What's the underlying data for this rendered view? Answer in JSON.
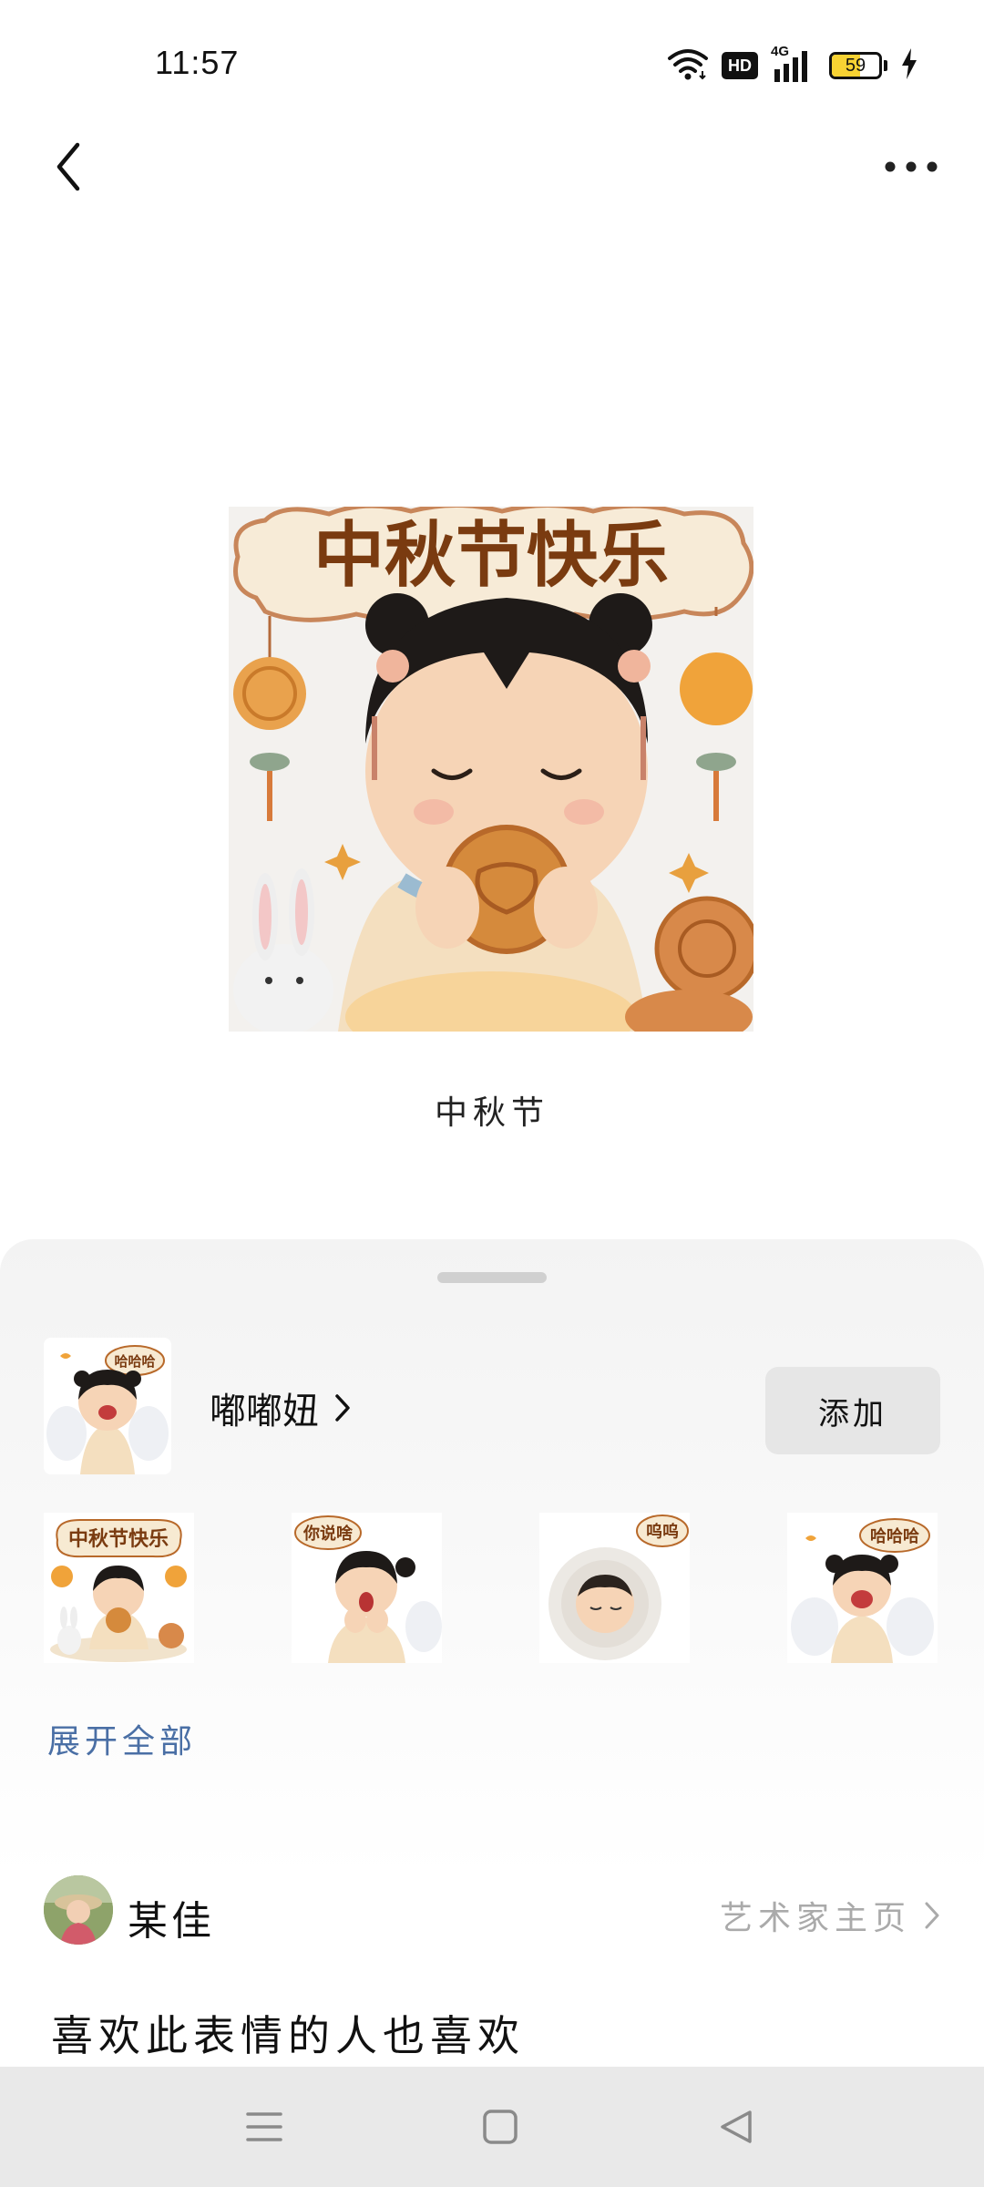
{
  "status_bar": {
    "time": "11:57",
    "hd_label": "HD",
    "network": "4G",
    "battery_level": "59",
    "battery_fraction": 0.59,
    "battery_color": "#f7d233"
  },
  "nav": {
    "back_icon": "chevron-left-icon",
    "more_icon": "more-horizontal-icon"
  },
  "sticker": {
    "banner_text": "中秋节快乐",
    "title": "中秋节"
  },
  "pack": {
    "thumb_bubble": "哈哈哈",
    "name": "嘟嘟妞",
    "add_label": "添加",
    "stickers": [
      {
        "bubble": "中秋节快乐"
      },
      {
        "bubble": "你说啥"
      },
      {
        "bubble": "呜呜"
      },
      {
        "bubble": "哈哈哈"
      }
    ],
    "expand_label": "展开全部"
  },
  "artist": {
    "name": "某佳",
    "link_label": "艺术家主页"
  },
  "also_like": {
    "heading": "喜欢此表情的人也喜欢"
  },
  "system_nav": {
    "menu_icon": "menu-icon",
    "home_icon": "square-home-icon",
    "back_icon": "triangle-back-icon"
  },
  "colors": {
    "link_blue": "#4a6fa5",
    "muted_gray": "#aaaaaa",
    "banner_brown": "#7a3b10"
  }
}
